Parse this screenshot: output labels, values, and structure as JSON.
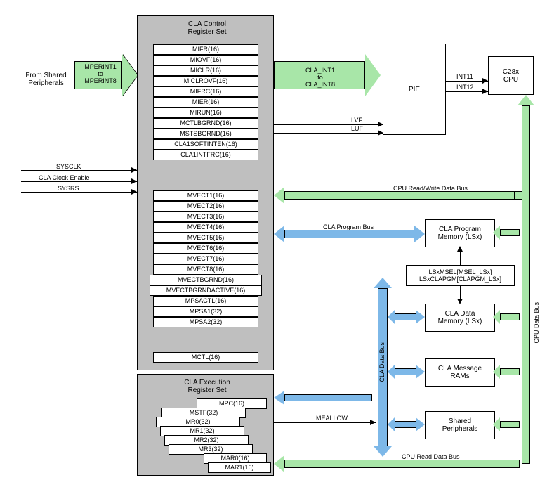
{
  "boxes": {
    "peripherals": "From Shared\nPeripherals",
    "pie": "PIE",
    "cpu": "C28x\nCPU",
    "cla_prog_mem": "CLA Program\nMemory (LSx)",
    "cla_data_mem": "CLA Data\nMemory (LSx)",
    "cla_msg_rams": "CLA Message\nRAMs",
    "shared_periph": "Shared\nPeripherals",
    "lsx_msel": "LSxMSEL[MSEL_LSx]\nLSxCLAPGM[CLAPGM_LSx]"
  },
  "titles": {
    "control_reg": "CLA Control\nRegister Set",
    "exec_reg": "CLA Execution\nRegister Set"
  },
  "arrows": {
    "mperint": "MPERINT1\nto\nMPERINT8",
    "cla_int": "CLA_INT1\nto\nCLA_INT8"
  },
  "signals": {
    "sysclk": "SYSCLK",
    "cla_clock": "CLA Clock Enable",
    "sysrs": "SYSRS",
    "lvf": "LVF",
    "luf": "LUF",
    "int11": "INT11",
    "int12": "INT12",
    "meallow": "MEALLOW",
    "cpu_rw_bus": "CPU Read/Write Data Bus",
    "cla_prog_bus": "CLA Program Bus",
    "cpu_read_bus": "CPU Read Data Bus",
    "cla_data_bus": "CLA Data Bus",
    "cpu_data_bus": "CPU Data Bus"
  },
  "regs_group1": [
    "MIFR(16)",
    "MIOVF(16)",
    "MICLR(16)",
    "MICLROVF(16)",
    "MIFRC(16)",
    "MIER(16)",
    "MIRUN(16)",
    "MCTLBGRND(16)",
    "MSTSBGRND(16)",
    "CLA1SOFTINTEN(16)",
    "CLA1INTFRC(16)"
  ],
  "regs_group2": [
    "MVECT1(16)",
    "MVECT2(16)",
    "MVECT3(16)",
    "MVECT4(16)",
    "MVECT5(16)",
    "MVECT6(16)",
    "MVECT7(16)",
    "MVECT8(16)",
    "MVECTBGRND(16)",
    "MVECTBGRNDACTIVE(16)",
    "MPSACTL(16)",
    "MPSA1(32)",
    "MPSA2(32)"
  ],
  "regs_mctl": "MCTL(16)",
  "regs_exec": [
    "MPC(16)",
    "MSTF(32)",
    "MR0(32)",
    "MR1(32)",
    "MR2(32)",
    "MR3(32)",
    "MAR0(16)",
    "MAR1(16)"
  ]
}
